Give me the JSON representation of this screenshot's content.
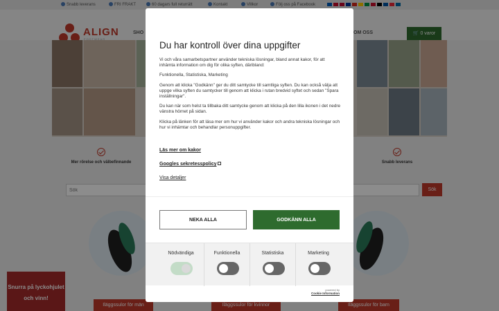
{
  "topbar": {
    "items": [
      {
        "label": "Snabb leverans",
        "icon": "clock-icon"
      },
      {
        "label": "FRI FRAKT",
        "icon": "truck-icon"
      },
      {
        "label": "60 dagars full returrätt",
        "icon": "calendar-icon"
      },
      {
        "label": "Kontakt",
        "icon": "phone-icon"
      },
      {
        "label": "Villkor",
        "icon": "document-icon"
      },
      {
        "label": "Följ oss på Facebook",
        "icon": "facebook-icon"
      }
    ],
    "flag_colors": [
      "#005bbb",
      "#c8102e",
      "#bf0a30",
      "#003399",
      "#d52b1e",
      "#ffcc00",
      "#009246",
      "#c8102e",
      "#000000",
      "#0055a4",
      "#ed2939",
      "#006aa7"
    ]
  },
  "header": {
    "logo_text": "ALIGN",
    "logo_sub": "FOOTWEAR",
    "nav_left": "SHO",
    "nav_right": "OM OSS",
    "cart_label": "0 varor",
    "brand_color": "#c0392b"
  },
  "features": [
    {
      "label": "Mer rörelse och välbefinnande"
    },
    {
      "label": "Snabb leverans"
    }
  ],
  "search": {
    "placeholder": "Sök",
    "button_label": "Sök"
  },
  "categories": [
    {
      "label": "Iläggssulor för män"
    },
    {
      "label": "Iläggssulor för kvinnor"
    },
    {
      "label": "Iläggssulor för barn"
    }
  ],
  "wheel_button": "Snurra på lyckohjulet och vinn!",
  "consent": {
    "title": "Du har kontroll över dina uppgifter",
    "intro": "Vi och våra samarbetspartner använder tekniska lösningar, bland annat kakor, för att inhämta information om dig för olika syften, däribland:",
    "purposes": "Funktionella, Statistiska, Marketing",
    "paragraph_1": "Genom att klicka \"Godkänn\" ger du ditt samtycke till samtliga syften. Du kan också välja att uppge vilka syften du samtycker till genom att klicka i rutan bredvid syftet och sedan \"Spara inställningar\".",
    "paragraph_2": "Du kan när som helst ta tillbaka ditt samtycke genom att klicka på den lilla ikonen i det nedre vänstra hörnet på sidan.",
    "paragraph_3": "Klicka på länken för att läsa mer om hur vi använder kakor och andra tekniska lösningar och hur vi inhämtar och behandlar personuppgifter.",
    "read_more": "Läs mer om kakor",
    "google_policy": "Googles sekretesspolicy",
    "details": "Visa detaljer",
    "deny_label": "NEKA ALLA",
    "accept_label": "GODKÄNN ALLA",
    "accept_color": "#2e6b2e",
    "toggles": [
      {
        "label": "Nödvändiga",
        "on": true
      },
      {
        "label": "Funktionella",
        "on": false
      },
      {
        "label": "Statistiska",
        "on": false
      },
      {
        "label": "Marketing",
        "on": false
      }
    ],
    "powered_by": "powered by",
    "powered_brand": "Cookie Information"
  }
}
